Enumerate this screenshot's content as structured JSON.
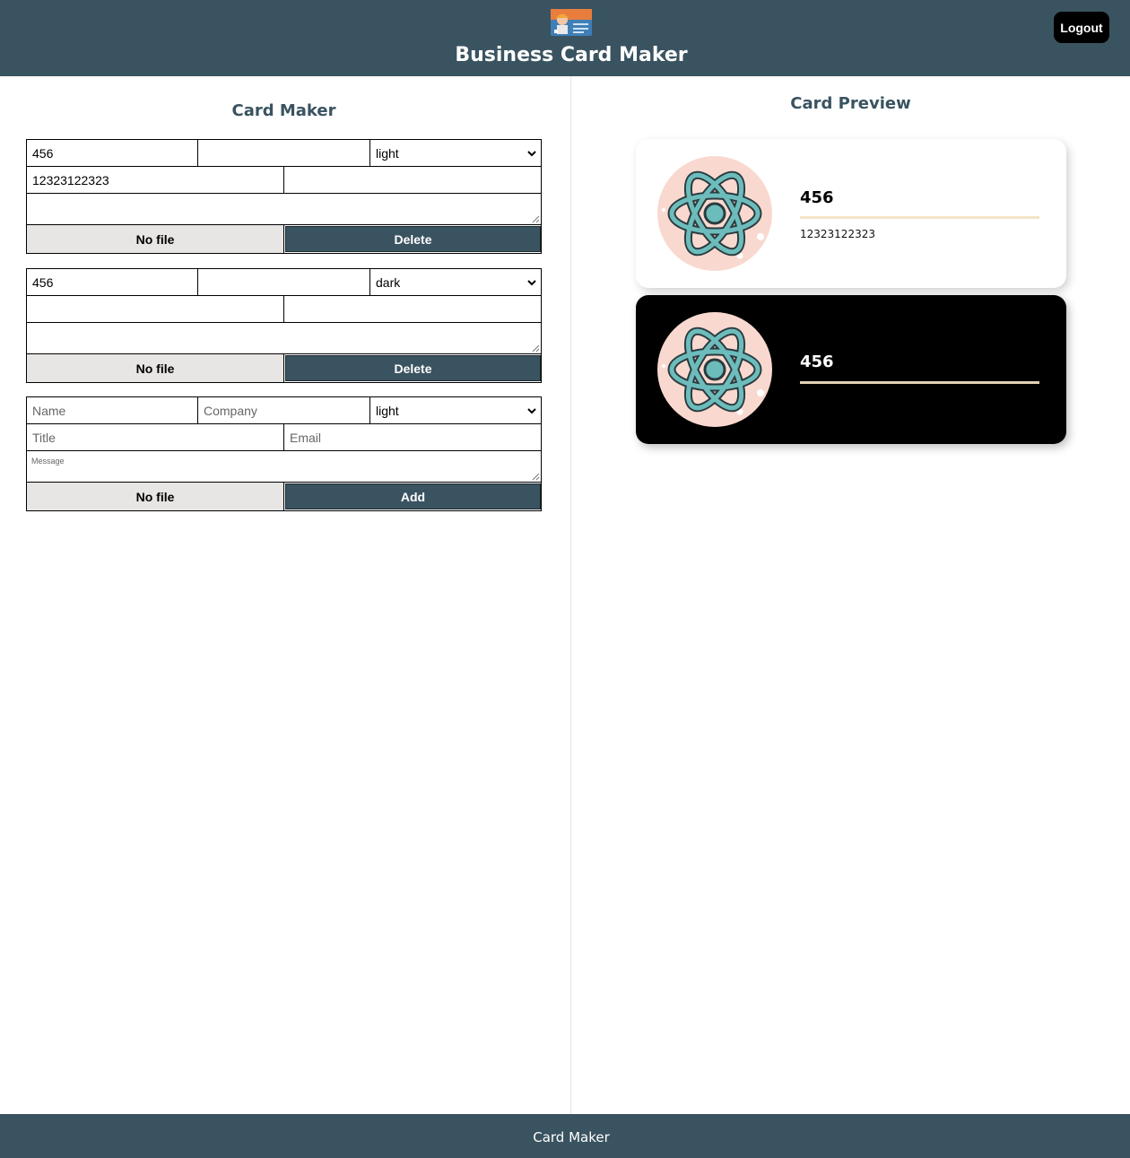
{
  "header": {
    "app_title": "Business Card Maker",
    "logo_icon": "business-card-icon",
    "logout_label": "Logout"
  },
  "colors": {
    "primary": "#3a5360",
    "file_button_bg": "#e8e6e5",
    "dark_card_bg": "#000000",
    "light_card_bg": "#ffffff",
    "avatar_bg": "#f9d9cf",
    "atom_teal": "#5fb3b3"
  },
  "maker": {
    "title": "Card Maker",
    "cards": [
      {
        "name": "456",
        "company": "",
        "theme": "light",
        "title": "12323122323",
        "email": "",
        "message": "",
        "file_label": "No file",
        "action_label": "Delete"
      },
      {
        "name": "456",
        "company": "",
        "theme": "dark",
        "title": "",
        "email": "",
        "message": "",
        "file_label": "No file",
        "action_label": "Delete"
      }
    ],
    "add_form": {
      "name_placeholder": "Name",
      "company_placeholder": "Company",
      "theme": "light",
      "title_placeholder": "Title",
      "email_placeholder": "Email",
      "message_placeholder": "Message",
      "file_label": "No file",
      "action_label": "Add"
    },
    "theme_options": [
      "light",
      "dark"
    ]
  },
  "preview": {
    "title": "Card Preview",
    "cards": [
      {
        "theme": "light",
        "name": "456",
        "title": "12323122323",
        "avatar_icon": "atom-icon"
      },
      {
        "theme": "dark",
        "name": "456",
        "title": "",
        "avatar_icon": "atom-icon"
      }
    ]
  },
  "footer": {
    "text": "Card Maker"
  }
}
